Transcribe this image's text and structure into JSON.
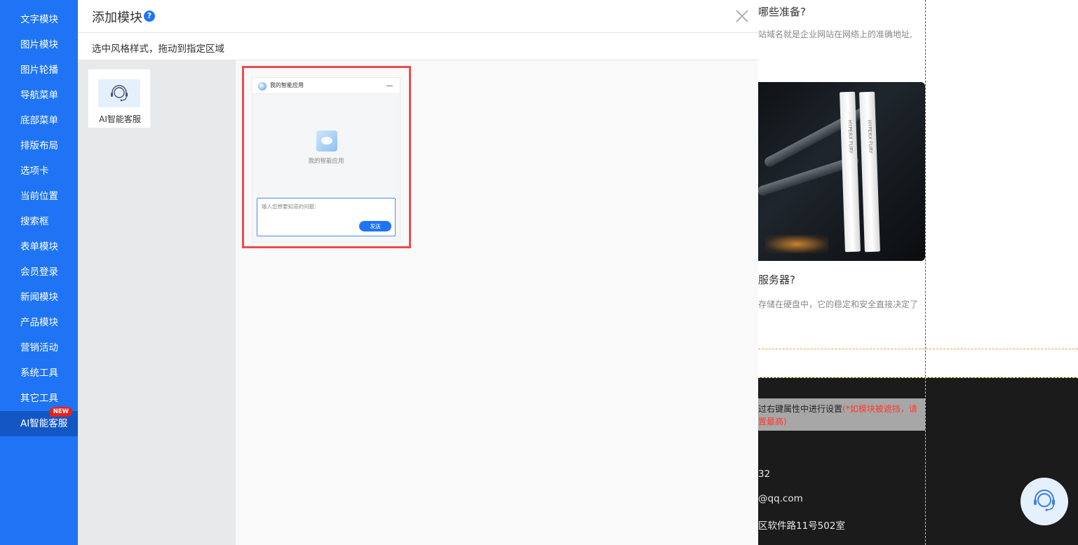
{
  "sidebar": {
    "items": [
      {
        "label": "文字模块"
      },
      {
        "label": "图片模块"
      },
      {
        "label": "图片轮播"
      },
      {
        "label": "导航菜单"
      },
      {
        "label": "底部菜单"
      },
      {
        "label": "排版布局"
      },
      {
        "label": "选项卡"
      },
      {
        "label": "当前位置"
      },
      {
        "label": "搜索框"
      },
      {
        "label": "表单模块"
      },
      {
        "label": "会员登录"
      },
      {
        "label": "新闻模块"
      },
      {
        "label": "产品模块"
      },
      {
        "label": "营销活动"
      },
      {
        "label": "系统工具"
      },
      {
        "label": "其它工具"
      },
      {
        "label": "AI智能客服",
        "badge": "NEW",
        "active": true
      }
    ]
  },
  "modal": {
    "title": "添加模块",
    "help_icon": "question-circle-icon",
    "close_icon": "close-icon",
    "subtitle": "选中风格样式，拖动到指定区域",
    "categories": [
      {
        "label": "AI智能客服",
        "icon": "headset-agent-icon"
      }
    ],
    "preview": {
      "header_title": "我的智能应用",
      "center_text": "我的智能应用",
      "input_placeholder": "输入您想要知道的问题：",
      "send_label": "发送"
    }
  },
  "background_page": {
    "heading1": "哪些准备?",
    "text1": "站域名就是企业网站在网络上的准确地址,",
    "heading2": "服务器?",
    "text2": "存储在硬盘中，它的稳定和安全直接决定了",
    "notice_text": "过右键属性中进行设置",
    "notice_warning1": "(*如模块被遮挡，请",
    "notice_warning2": "置最高)",
    "contact_phone": "32",
    "contact_email": "@qq.com",
    "contact_address": "区软件路11号502室",
    "ram_label": "HYPERX FURY"
  },
  "colors": {
    "sidebar_bg": "#1e74f5",
    "sidebar_active": "#1357c5",
    "highlight_border": "#ee4b4b",
    "badge": "#e8211a",
    "send_button": "#1e74f5"
  }
}
